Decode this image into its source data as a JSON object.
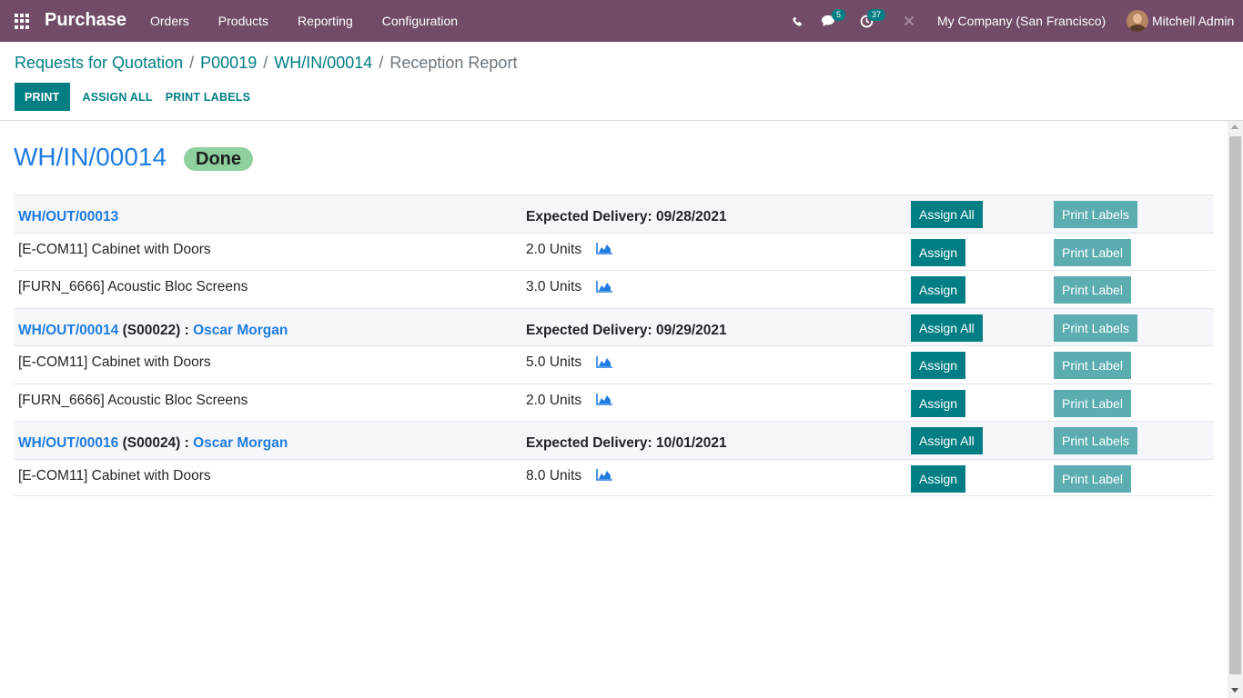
{
  "navbar": {
    "brand": "Purchase",
    "menu": [
      "Orders",
      "Products",
      "Reporting",
      "Configuration"
    ],
    "messages_count": "5",
    "activities_count": "37",
    "company": "My Company (San Francisco)",
    "user": "Mitchell Admin"
  },
  "breadcrumb": {
    "items": [
      "Requests for Quotation",
      "P00019",
      "WH/IN/00014"
    ],
    "active": "Reception Report",
    "separator": "/"
  },
  "actions": {
    "print": "PRINT",
    "assign_all": "ASSIGN ALL",
    "print_labels": "PRINT LABELS"
  },
  "report": {
    "title": "WH/IN/00014",
    "state": "Done",
    "groups": [
      {
        "picking": "WH/OUT/00013",
        "origin": "",
        "partner": "",
        "expected_label": "Expected Delivery:",
        "expected_date": "09/28/2021",
        "assign_all_label": "Assign All",
        "print_labels_label": "Print Labels",
        "lines": [
          {
            "product": "[E-COM11] Cabinet with Doors",
            "qty": "2.0 Units",
            "assign_label": "Assign",
            "print_label": "Print Label"
          },
          {
            "product": "[FURN_6666] Acoustic Bloc Screens",
            "qty": "3.0 Units",
            "assign_label": "Assign",
            "print_label": "Print Label"
          }
        ]
      },
      {
        "picking": "WH/OUT/00014",
        "origin": "(S00022) :",
        "partner": "Oscar Morgan",
        "expected_label": "Expected Delivery:",
        "expected_date": "09/29/2021",
        "assign_all_label": "Assign All",
        "print_labels_label": "Print Labels",
        "lines": [
          {
            "product": "[E-COM11] Cabinet with Doors",
            "qty": "5.0 Units",
            "assign_label": "Assign",
            "print_label": "Print Label"
          },
          {
            "product": "[FURN_6666] Acoustic Bloc Screens",
            "qty": "2.0 Units",
            "assign_label": "Assign",
            "print_label": "Print Label"
          }
        ]
      },
      {
        "picking": "WH/OUT/00016",
        "origin": "(S00024) :",
        "partner": "Oscar Morgan",
        "expected_label": "Expected Delivery:",
        "expected_date": "10/01/2021",
        "assign_all_label": "Assign All",
        "print_labels_label": "Print Labels",
        "lines": [
          {
            "product": "[E-COM11] Cabinet with Doors",
            "qty": "8.0 Units",
            "assign_label": "Assign",
            "print_label": "Print Label"
          }
        ]
      }
    ]
  },
  "colors": {
    "navbar": "#714B67",
    "primary": "#017e84",
    "primary_light": "#5cadb1",
    "link": "#1f7ce0",
    "done_badge": "#8fd19e"
  }
}
